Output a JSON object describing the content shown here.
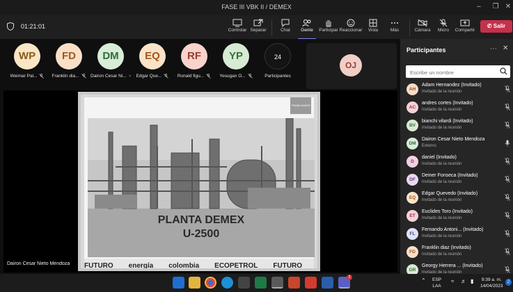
{
  "window": {
    "title": "FASE III VBK II / DEMEX"
  },
  "meeting": {
    "timer": "01:21:01"
  },
  "toolbar": {
    "controlar": "Controlar",
    "compartir": "Separar",
    "chat": "Chat",
    "gente": "Gente",
    "participar": "Participar",
    "reaccionar": "Reaccionar",
    "vista": "Vista",
    "mas": "Más",
    "camara": "Cámara",
    "micro": "Micro",
    "compartir2": "Compartir",
    "salir": "Salir"
  },
  "tiles": [
    {
      "initials": "WP",
      "name": "Weimar Pal...",
      "bg": "#f8e6c4",
      "fg": "#8a5a1a"
    },
    {
      "initials": "FD",
      "name": "Franklin dia...",
      "bg": "#f8e0c8",
      "fg": "#9a5a20"
    },
    {
      "initials": "DM",
      "name": "Dairon Cesar Ni...",
      "bg": "#d8ecd8",
      "fg": "#2e6b3a"
    },
    {
      "initials": "EQ",
      "name": "Edgar Que...",
      "bg": "#fbe3c8",
      "fg": "#a2571d"
    },
    {
      "initials": "RF",
      "name": "Ronald figu...",
      "bg": "#f7d3cc",
      "fg": "#9c3b31"
    },
    {
      "initials": "YP",
      "name": "Yesugan O...",
      "bg": "#d7ead3",
      "fg": "#39713a"
    }
  ],
  "overflow": {
    "count": "24",
    "label": "Participantes"
  },
  "self_tile": {
    "initials": "OJ"
  },
  "slide": {
    "title_line1": "PLANTA DEMEX",
    "title_line2": "U-2500",
    "footer_words": [
      "FUTURO",
      "energía",
      "colombia",
      "ECOPETROL",
      "FUTURO"
    ],
    "badge": "TRABAJAMOS"
  },
  "presenter": {
    "name": "Dairon Cesar Nieto Mendoza"
  },
  "panel": {
    "title": "Participantes",
    "search_placeholder": "Escribe un nombre",
    "participants": [
      {
        "initials": "AH",
        "name": "Adam Hernandez (Invitado)",
        "sub": "Invitado de la reunión",
        "bg": "#f8dcc8",
        "fg": "#9a4e1a",
        "mic": "muted"
      },
      {
        "initials": "AC",
        "name": "andres cortes (Invitado)",
        "sub": "Invitado de la reunión",
        "bg": "#f7d0d8",
        "fg": "#9a2f4a",
        "mic": "muted"
      },
      {
        "initials": "BV",
        "name": "bianchi vilardi (Invitado)",
        "sub": "Invitado de la reunión",
        "bg": "#d7ead3",
        "fg": "#39713a",
        "mic": "muted"
      },
      {
        "initials": "DM",
        "name": "Dairon Cesar Nieto Mendoza",
        "sub": "Externo",
        "bg": "#d8ecd8",
        "fg": "#2e6b3a",
        "mic": "on"
      },
      {
        "initials": "D",
        "name": "daniel (Invitado)",
        "sub": "Invitado de la reunión",
        "bg": "#f2d0e4",
        "fg": "#8b2f66",
        "mic": "muted"
      },
      {
        "initials": "DF",
        "name": "Deiner Fonseca (Invitado)",
        "sub": "Invitado de la reunión",
        "bg": "#ead7f0",
        "fg": "#6b3a86",
        "mic": "muted"
      },
      {
        "initials": "EQ",
        "name": "Edgar Quevedo (Invitado)",
        "sub": "Invitado de la reunión",
        "bg": "#fbe3c8",
        "fg": "#a2571d",
        "mic": "muted"
      },
      {
        "initials": "ET",
        "name": "Euclides Toro (Invitado)",
        "sub": "Invitado de la reunión",
        "bg": "#f7d0d8",
        "fg": "#9a2f4a",
        "mic": "muted"
      },
      {
        "initials": "FL",
        "name": "Fernando Antoni...  (Invitado)",
        "sub": "Invitado de la reunión",
        "bg": "#dfe3f5",
        "fg": "#3c4a8c",
        "mic": "muted"
      },
      {
        "initials": "FD",
        "name": "Franklin diaz (Invitado)",
        "sub": "Invitado de la reunión",
        "bg": "#f8e0c8",
        "fg": "#9a5a20",
        "mic": "muted"
      },
      {
        "initials": "GR",
        "name": "Georgy Herrera ...  (Invitado)",
        "sub": "Invitado de la reunión",
        "bg": "#d7ead3",
        "fg": "#39713a",
        "mic": "muted"
      }
    ]
  },
  "taskbar": {
    "lang_top": "ESP",
    "lang_bottom": "LAA",
    "time": "9:39 a. m.",
    "date": "14/04/2023",
    "notif": "2"
  },
  "colors": {
    "accent": "#7f85f5",
    "leave": "#c4314b"
  }
}
